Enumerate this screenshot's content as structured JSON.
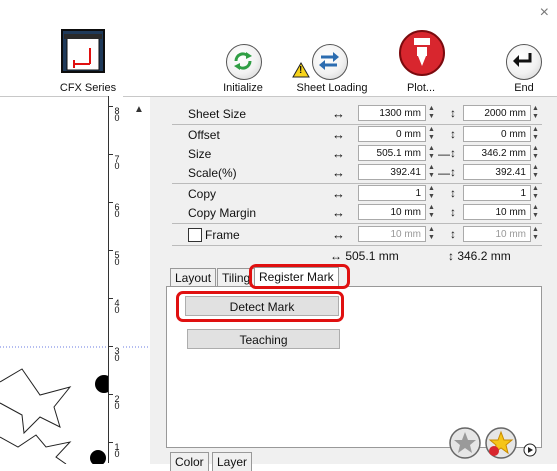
{
  "window": {
    "close_glyph": "×"
  },
  "toolbar": {
    "model_label": "CFX Series",
    "initialize_label": "Initialize",
    "sheet_loading_label": "Sheet Loading",
    "plot_label": "Plot...",
    "end_label": "End",
    "warning_glyph": "!"
  },
  "ruler": {
    "labels": [
      "8",
      "0",
      "7",
      "0",
      "6",
      "0",
      "5",
      "0",
      "4",
      "0",
      "3",
      "0",
      "2",
      "0",
      "1",
      "0"
    ]
  },
  "settings": {
    "rows": [
      {
        "name": "Sheet Size",
        "h_value": "1300 mm",
        "v_value": "2000 mm"
      },
      {
        "name": "Offset",
        "h_value": "0 mm",
        "v_value": "0 mm"
      },
      {
        "name": "Size",
        "h_value": "505.1 mm",
        "v_value": "346.2 mm"
      },
      {
        "name": "Scale(%)",
        "h_value": "392.41",
        "v_value": "392.41"
      },
      {
        "name": "Copy",
        "h_value": "1",
        "v_value": "1"
      },
      {
        "name": "Copy Margin",
        "h_value": "10 mm",
        "v_value": "10 mm"
      },
      {
        "name": "Frame",
        "h_value": "10 mm",
        "v_value": "10 mm"
      }
    ],
    "total_width": "↔ 505.1 mm",
    "total_height": "↕ 346.2 mm"
  },
  "tabs": {
    "layout": "Layout",
    "tiling": "Tiling",
    "register_mark": "Register Mark"
  },
  "register_mark": {
    "detect_label": "Detect Mark",
    "teaching_label": "Teaching"
  },
  "bottom_tabs": {
    "color": "Color",
    "layer": "Layer"
  },
  "colors": {
    "highlight": "#e01010",
    "plot_red": "#d8262e",
    "init_green": "#2f9e44",
    "sheet_blue": "#2b6cb0"
  }
}
